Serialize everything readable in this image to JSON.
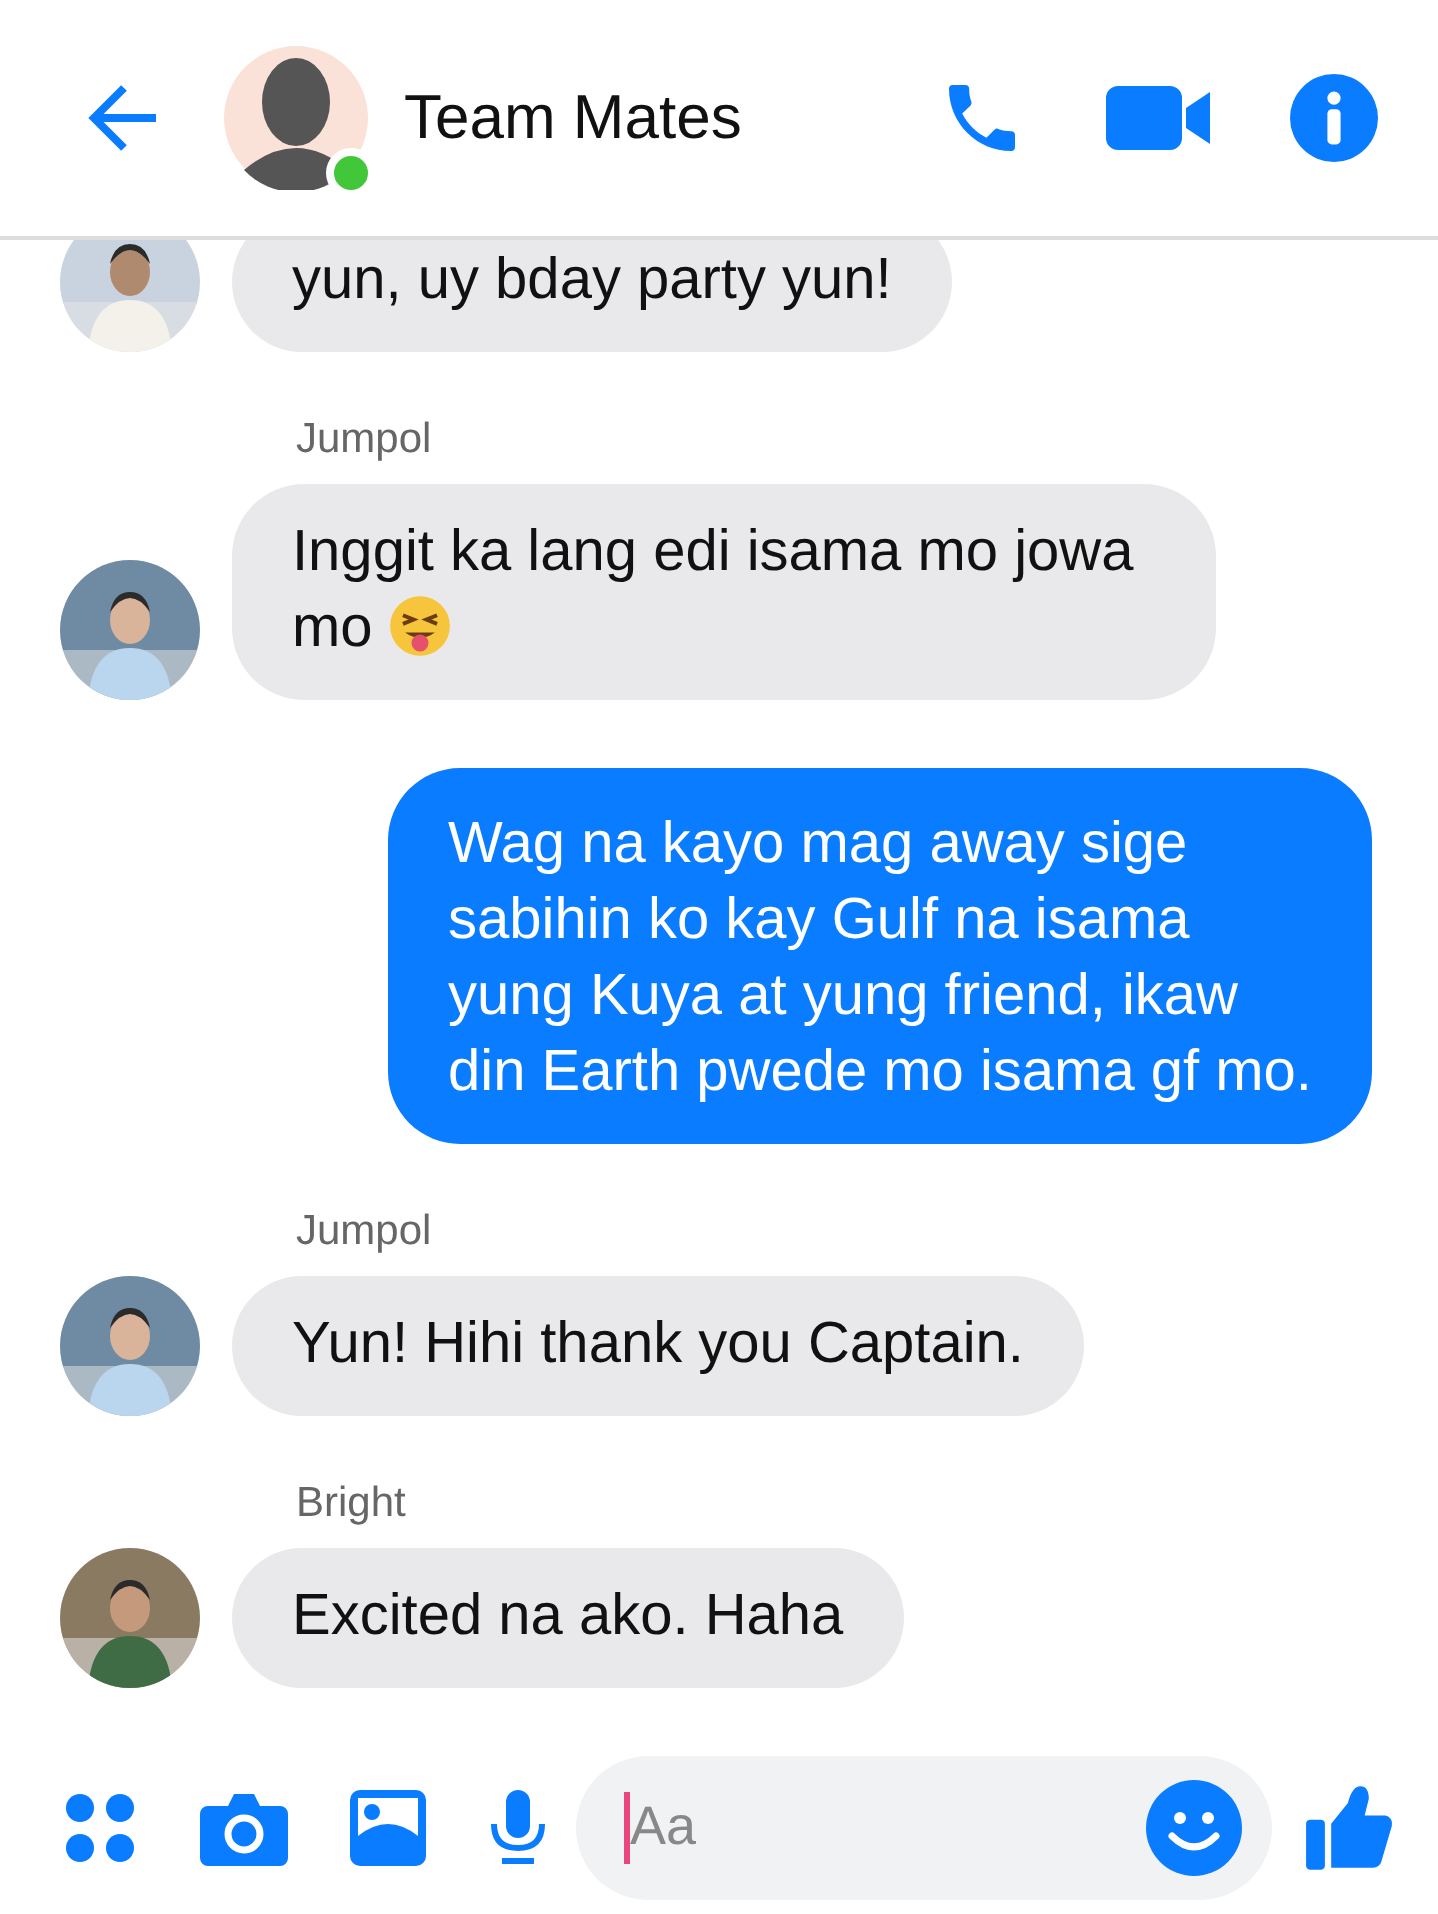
{
  "header": {
    "title": "Team Mates",
    "online": true
  },
  "messages": [
    {
      "kind": "incoming",
      "text": "yun, uy bday party yun!"
    },
    {
      "kind": "incoming",
      "sender": "Jumpol",
      "text": "Inggit ka lang edi isama mo jowa mo",
      "trailing_emoji": true
    },
    {
      "kind": "outgoing",
      "text": "Wag na kayo mag away sige sabihin ko kay Gulf na isama yung Kuya at yung friend, ikaw din Earth pwede mo isama gf mo."
    },
    {
      "kind": "incoming",
      "sender": "Jumpol",
      "text": "Yun! Hihi thank you Captain."
    },
    {
      "kind": "incoming",
      "sender": "Bright",
      "text": "Excited na ako. Haha"
    }
  ],
  "composer": {
    "placeholder": "Aa"
  }
}
